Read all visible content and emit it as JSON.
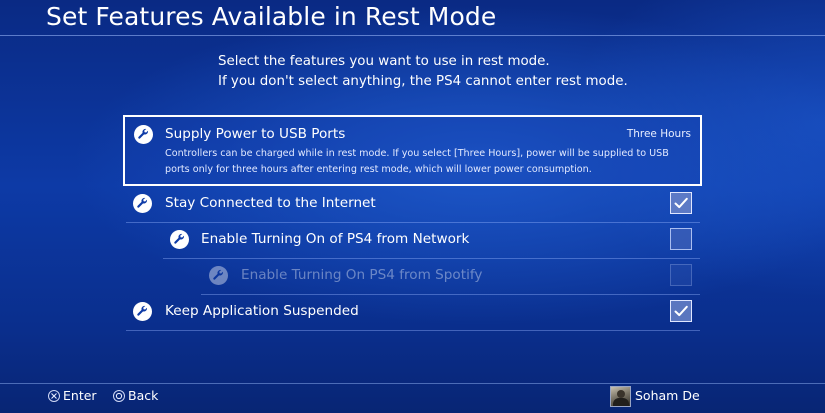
{
  "header": {
    "title": "Set Features Available in Rest Mode"
  },
  "intro": {
    "line1": "Select the features you want to use in rest mode.",
    "line2": "If you don't select anything, the PS4 cannot enter rest mode."
  },
  "options": {
    "usb_power": {
      "label": "Supply Power to USB Ports",
      "value": "Three Hours",
      "description": "Controllers can be charged while in rest mode. If you select [Three Hours], power will be supplied to USB ports only for three hours after entering rest mode, which will lower power consumption.",
      "icon": "wrench-icon"
    },
    "stay_connected": {
      "label": "Stay Connected to the Internet",
      "checked": true,
      "icon": "wrench-icon"
    },
    "network_turn_on": {
      "label": "Enable Turning On of PS4 from Network",
      "checked": false,
      "icon": "wrench-icon"
    },
    "spotify_turn_on": {
      "label": "Enable Turning On PS4 from Spotify",
      "checked": false,
      "disabled": true,
      "icon": "wrench-icon"
    },
    "keep_suspended": {
      "label": "Keep Application Suspended",
      "checked": true,
      "icon": "wrench-icon"
    }
  },
  "footer": {
    "enter_label": "Enter",
    "enter_icon": "cross-button-icon",
    "back_label": "Back",
    "back_icon": "circle-button-icon",
    "user_name": "Soham De"
  },
  "colors": {
    "background": "#0d3aa6",
    "focus_border": "#ffffff",
    "text": "#ffffff"
  }
}
